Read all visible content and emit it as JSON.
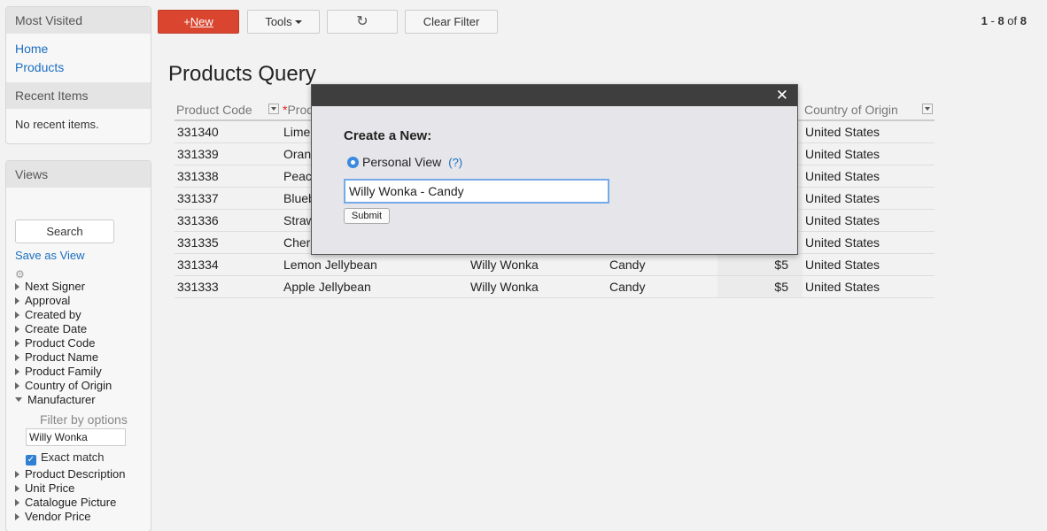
{
  "sidebar": {
    "most_visited": {
      "title": "Most Visited",
      "links": [
        "Home",
        "Products"
      ]
    },
    "recent_items": {
      "title": "Recent Items",
      "empty_text": "No recent items."
    },
    "views": {
      "title": "Views",
      "search_label": "Search",
      "save_as_view": "Save as View",
      "tree_top": [
        "Next Signer",
        "Approval",
        "Created by",
        "Create Date",
        "Product Code",
        "Product Name",
        "Product Family",
        "Country of Origin"
      ],
      "expanded_item": "Manufacturer",
      "filter_title": "Filter by options",
      "filter_value": "Willy Wonka",
      "exact_match_label": "Exact match",
      "exact_match_checked": true,
      "tree_bottom": [
        "Product Description",
        "Unit Price",
        "Catalogue Picture",
        "Vendor Price"
      ]
    }
  },
  "toolbar": {
    "new_label": "New",
    "tools_label": "Tools",
    "refresh_icon": "↻",
    "clear_filter_label": "Clear Filter",
    "pager": {
      "from": "1",
      "to": "8",
      "total": "8",
      "dash": " - ",
      "of": " of "
    }
  },
  "page": {
    "title": "Products Query"
  },
  "table": {
    "columns": [
      "Product Code",
      "Prod",
      "Country of Origin"
    ],
    "rows": [
      {
        "code": "331340",
        "name": "Lime",
        "mfr": "",
        "family": "",
        "price": "",
        "country": "United States"
      },
      {
        "code": "331339",
        "name": "Oran",
        "mfr": "",
        "family": "",
        "price": "",
        "country": "United States"
      },
      {
        "code": "331338",
        "name": "Peac",
        "mfr": "",
        "family": "",
        "price": "",
        "country": "United States"
      },
      {
        "code": "331337",
        "name": "Blueb",
        "mfr": "",
        "family": "",
        "price": "",
        "country": "United States"
      },
      {
        "code": "331336",
        "name": "Straw",
        "mfr": "",
        "family": "",
        "price": "",
        "country": "United States"
      },
      {
        "code": "331335",
        "name": "Cher",
        "mfr": "",
        "family": "",
        "price": "",
        "country": "United States"
      },
      {
        "code": "331334",
        "name": "Lemon Jellybean",
        "mfr": "Willy Wonka",
        "family": "Candy",
        "price": "$5",
        "country": "United States"
      },
      {
        "code": "331333",
        "name": "Apple Jellybean",
        "mfr": "Willy Wonka",
        "family": "Candy",
        "price": "$5",
        "country": "United States"
      }
    ]
  },
  "modal": {
    "close_icon": "✕",
    "title": "Create a New:",
    "option_label": "Personal View",
    "help_label": "(?)",
    "input_value": "Willy Wonka - Candy",
    "submit_label": "Submit"
  },
  "colors": {
    "accent": "#d9452f",
    "link": "#1a6ec0",
    "modal_bar": "#3e3e3e"
  }
}
